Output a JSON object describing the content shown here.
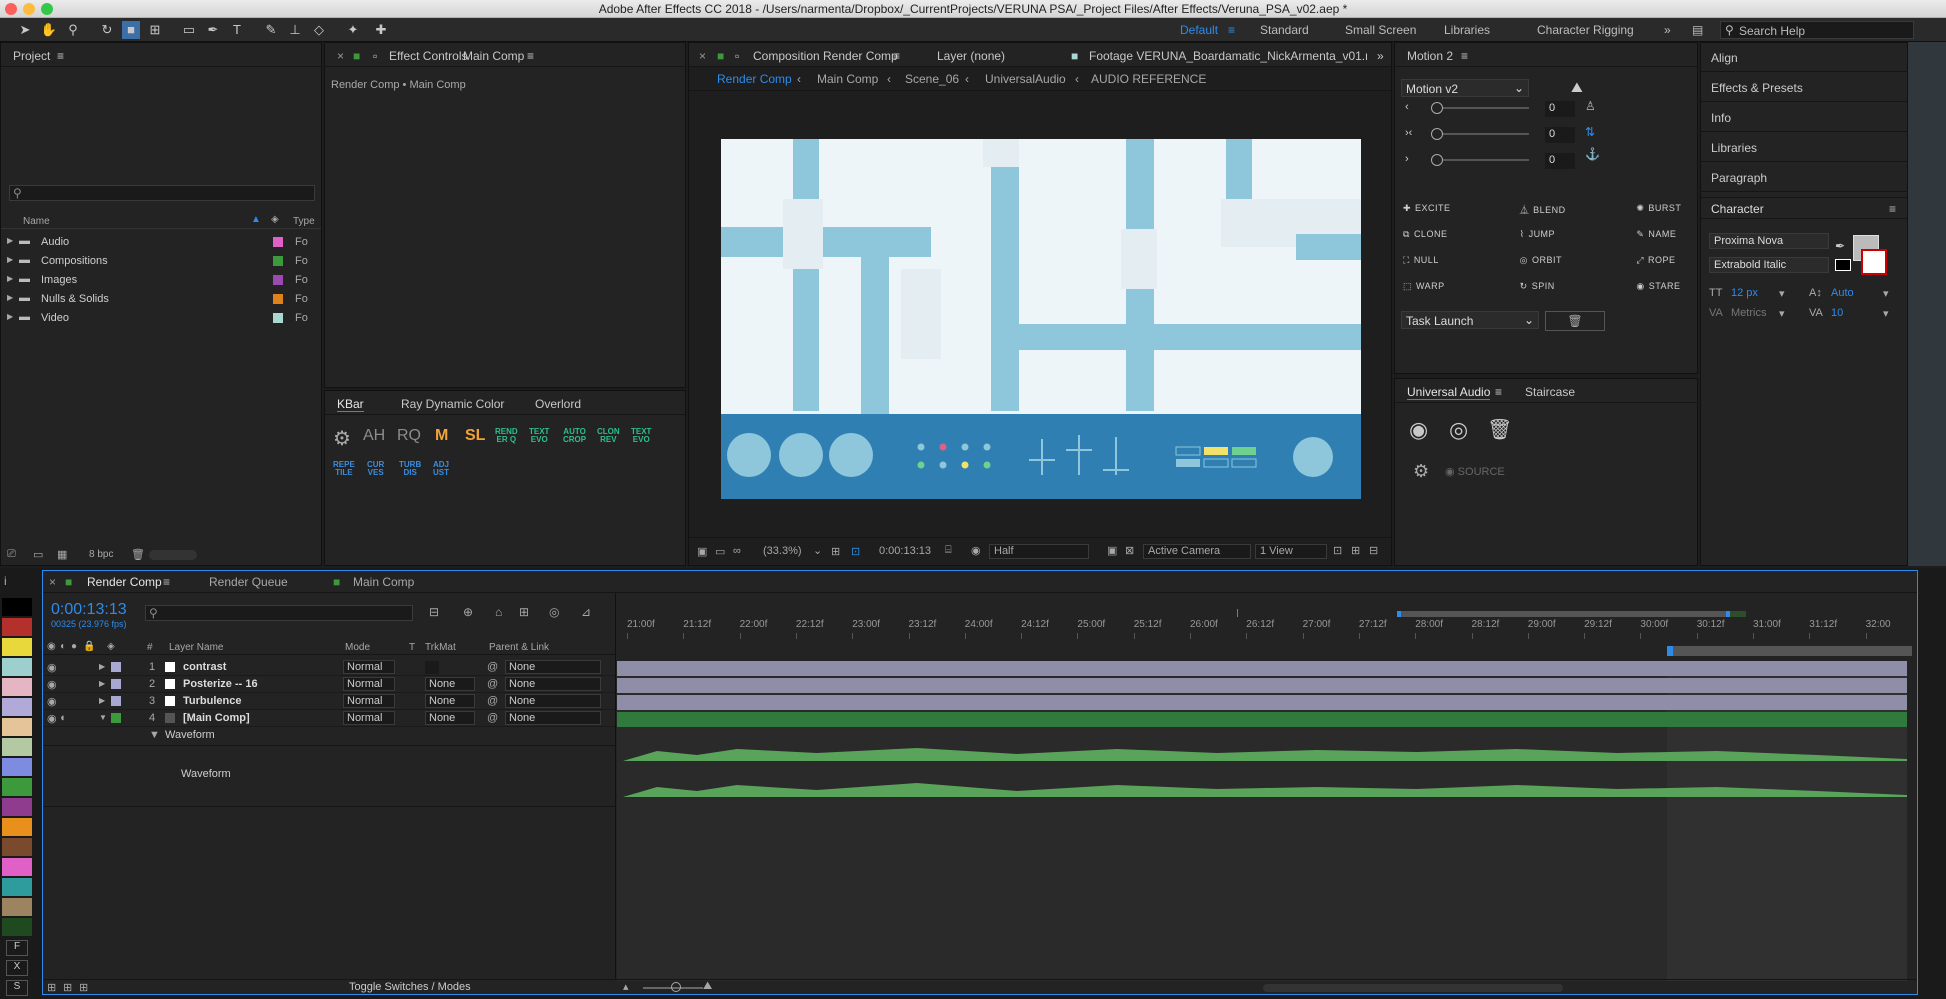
{
  "window": {
    "title": "Adobe After Effects CC 2018 - /Users/narmenta/Dropbox/_CurrentProjects/VERUNA PSA/_Project Files/After Effects/Veruna_PSA_v02.aep *"
  },
  "workspaces": {
    "items": [
      "Default",
      "Standard",
      "Small Screen",
      "Libraries",
      "Character Rigging"
    ],
    "search": "Search Help"
  },
  "project": {
    "title": "Project",
    "cols": [
      "Name",
      "Type"
    ],
    "folders": [
      {
        "name": "Audio",
        "type": "Fo",
        "color": "#e160c8"
      },
      {
        "name": "Compositions",
        "type": "Fo",
        "color": "#3c9a3c"
      },
      {
        "name": "Images",
        "type": "Fo",
        "color": "#9a4ab0"
      },
      {
        "name": "Nulls & Solids",
        "type": "Fo",
        "color": "#e0821b"
      },
      {
        "name": "Video",
        "type": "Fo",
        "color": "#a8d8d0"
      }
    ],
    "bpc": "8 bpc"
  },
  "effects": {
    "tab": "Effect Controls",
    "comp": "Main Comp",
    "breadcrumb": "Render Comp • Main Comp"
  },
  "kbar": {
    "tabs": [
      "KBar",
      "Ray Dynamic Color",
      "Overlord"
    ],
    "big": [
      "AH",
      "RQ",
      "M",
      "SL"
    ],
    "small": [
      [
        "REND",
        "ER Q"
      ],
      [
        "TEXT",
        "EVO"
      ],
      [
        "AUTO",
        "CROP"
      ],
      [
        "CLON",
        "REV"
      ],
      [
        "TEXT",
        "EVO"
      ]
    ],
    "small2": [
      [
        "REPE",
        "TILE"
      ],
      [
        "CUR",
        "VES"
      ],
      [
        "TURB",
        "DIS"
      ],
      [
        "ADJ",
        "UST"
      ]
    ]
  },
  "comp": {
    "tab": "Composition",
    "name": "Render Comp",
    "layer": "Layer (none)",
    "footage": "Footage VERUNA_Boardamatic_NickArmenta_v01.mp",
    "crumbs": [
      "Render Comp",
      "Main Comp",
      "Scene_06",
      "UniversalAudio",
      "AUDIO REFERENCE"
    ],
    "zoom": "(33.3%)",
    "time": "0:00:13:13",
    "res": "Half",
    "camera": "Active Camera",
    "view": "1 View"
  },
  "motion": {
    "tab": "Motion 2",
    "preset": "Motion v2",
    "sliders": [
      "0",
      "0",
      "0"
    ],
    "buttons": [
      "EXCITE",
      "BLEND",
      "BURST",
      "CLONE",
      "JUMP",
      "NAME",
      "NULL",
      "ORBIT",
      "ROPE",
      "WARP",
      "SPIN",
      "STARE"
    ],
    "task": "Task Launch"
  },
  "audio": {
    "tabs": [
      "Universal Audio",
      "Staircase"
    ],
    "source": "SOURCE"
  },
  "right": {
    "items": [
      "Align",
      "Effects & Presets",
      "Info",
      "Libraries",
      "Paragraph"
    ],
    "char": {
      "title": "Character",
      "font": "Proxima Nova",
      "style": "Extrabold Italic",
      "size": "12 px",
      "leading": "Auto",
      "kern": "Metrics",
      "track": "10"
    }
  },
  "timeline": {
    "tabs": [
      "Render Comp",
      "Render Queue",
      "Main Comp"
    ],
    "time": "0:00:13:13",
    "fps": "00325 (23.976 fps)",
    "cols": [
      "#",
      "Layer Name",
      "Mode",
      "T",
      "TrkMat",
      "Parent & Link"
    ],
    "layers": [
      {
        "num": "1",
        "name": "contrast",
        "mode": "Normal",
        "trk": "",
        "parent": "None"
      },
      {
        "num": "2",
        "name": "Posterize -- 16",
        "mode": "Normal",
        "trk": "None",
        "parent": "None"
      },
      {
        "num": "3",
        "name": "Turbulence",
        "mode": "Normal",
        "trk": "None",
        "parent": "None"
      },
      {
        "num": "4",
        "name": "[Main Comp]",
        "mode": "Normal",
        "trk": "None",
        "parent": "None"
      }
    ],
    "waveform": "Waveform",
    "waveform2": "Waveform",
    "ruler": [
      "21:00f",
      "21:12f",
      "22:00f",
      "22:12f",
      "23:00f",
      "23:12f",
      "24:00f",
      "24:12f",
      "25:00f",
      "25:12f",
      "26:00f",
      "26:12f",
      "27:00f",
      "27:12f",
      "28:00f",
      "28:12f",
      "29:00f",
      "29:12f",
      "30:00f",
      "30:12f",
      "31:00f",
      "31:12f",
      "32:00"
    ],
    "toggle": "Toggle Switches / Modes",
    "letters": [
      "F",
      "X",
      "S"
    ]
  }
}
